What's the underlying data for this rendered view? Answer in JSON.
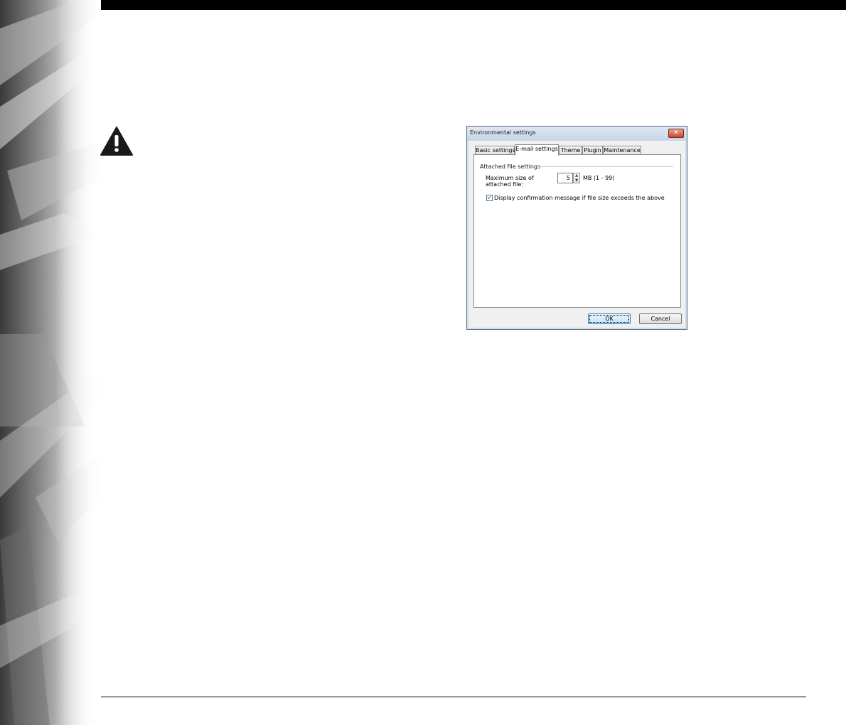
{
  "page": {
    "warning_icon": "warning-triangle-icon",
    "background_art": "abstract-gray-swoosh"
  },
  "dialog": {
    "title": "Environmental settings",
    "close_icon": "close-icon",
    "tabs": [
      {
        "label": "Basic settings",
        "active": false
      },
      {
        "label": "E-mail settings",
        "active": true
      },
      {
        "label": "Theme",
        "active": false
      },
      {
        "label": "Plugin",
        "active": false
      },
      {
        "label": "Maintenance",
        "active": false
      }
    ],
    "group_label": "Attached file settings",
    "max_size_label": "Maximum size of attached file:",
    "max_size_value": "5",
    "max_size_unit": "MB (1 - 99)",
    "confirm_checkbox": {
      "checked": true,
      "label": "Display confirmation message if file size exceeds the above"
    },
    "ok_label": "OK",
    "cancel_label": "Cancel"
  }
}
